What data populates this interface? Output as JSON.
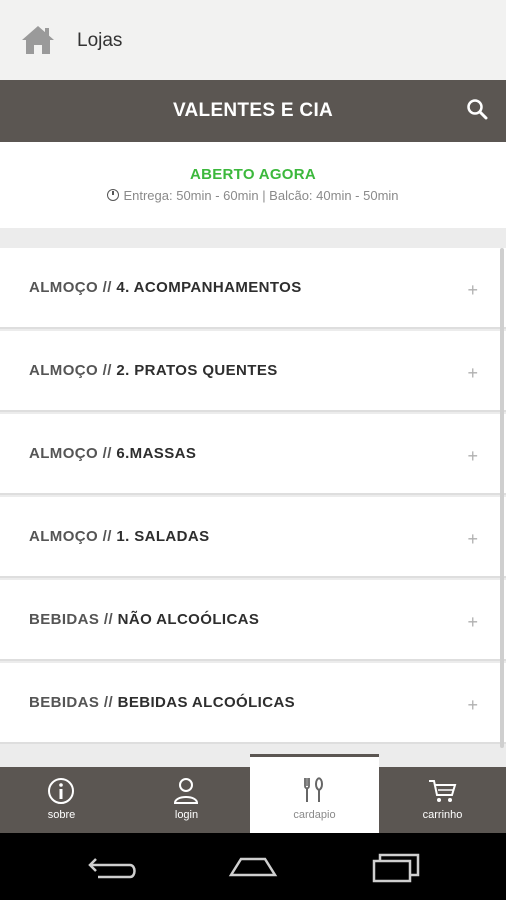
{
  "topbar": {
    "title": "Lojas",
    "icon": "home-icon"
  },
  "store": {
    "name": "VALENTES E CIA",
    "search_icon": "search-icon"
  },
  "status": {
    "open_label": "ABERTO AGORA",
    "delivery_info": "Entrega: 50min - 60min | Balcão: 40min - 50min"
  },
  "menu": {
    "items": [
      {
        "category": "ALMOÇO",
        "separator": "//",
        "name": "4. ACOMPANHAMENTOS"
      },
      {
        "category": "ALMOÇO",
        "separator": "//",
        "name": "2. PRATOS QUENTES"
      },
      {
        "category": "ALMOÇO",
        "separator": "//",
        "name": "6.MASSAS"
      },
      {
        "category": "ALMOÇO",
        "separator": "//",
        "name": "1. SALADAS"
      },
      {
        "category": "BEBIDAS",
        "separator": "//",
        "name": "NÃO ALCOÓLICAS"
      },
      {
        "category": "BEBIDAS",
        "separator": "//",
        "name": "BEBIDAS ALCOÓLICAS"
      }
    ],
    "expand_symbol": "+"
  },
  "tabs": [
    {
      "label": "sobre",
      "icon": "info-icon"
    },
    {
      "label": "login",
      "icon": "user-icon"
    },
    {
      "label": "cardapio",
      "icon": "cutlery-icon",
      "active": true
    },
    {
      "label": "carrinho",
      "icon": "cart-icon"
    }
  ],
  "colors": {
    "header_bg": "#5b5652",
    "open_green": "#3cb83c",
    "topbar_bg": "#f2f2f1"
  }
}
